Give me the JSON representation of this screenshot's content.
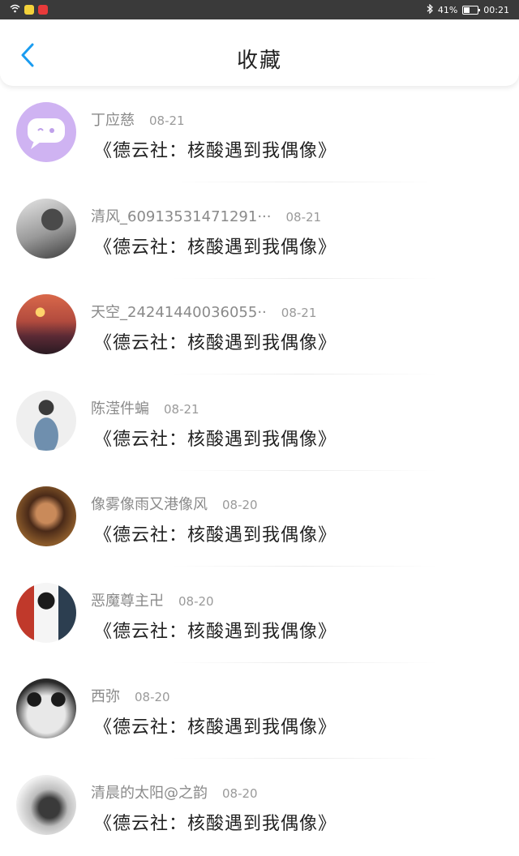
{
  "status_bar": {
    "battery": "41%",
    "time": "00:21"
  },
  "header": {
    "title": "收藏"
  },
  "favorites": [
    {
      "user": "丁应慈",
      "date": "08-21",
      "title": "《德云社：核酸遇到我偶像》"
    },
    {
      "user": "清风_60913531471291···",
      "date": "08-21",
      "title": "《德云社：核酸遇到我偶像》"
    },
    {
      "user": "天空_24241440036055··",
      "date": "08-21",
      "title": "《德云社：核酸遇到我偶像》"
    },
    {
      "user": "陈滢件蝙",
      "date": "08-21",
      "title": "《德云社：核酸遇到我偶像》"
    },
    {
      "user": "像雾像雨又港像风",
      "date": "08-20",
      "title": "《德云社：核酸遇到我偶像》"
    },
    {
      "user": "恶魔尊主卍",
      "date": "08-20",
      "title": "《德云社：核酸遇到我偶像》"
    },
    {
      "user": "西弥",
      "date": "08-20",
      "title": "《德云社：核酸遇到我偶像》"
    },
    {
      "user": "清晨的太阳@之韵",
      "date": "08-20",
      "title": "《德云社：核酸遇到我偶像》"
    }
  ],
  "colors": {
    "accent": "#1a9cf0",
    "status_bar": "#3a3a3a",
    "default_avatar": "#cfb3f2"
  }
}
